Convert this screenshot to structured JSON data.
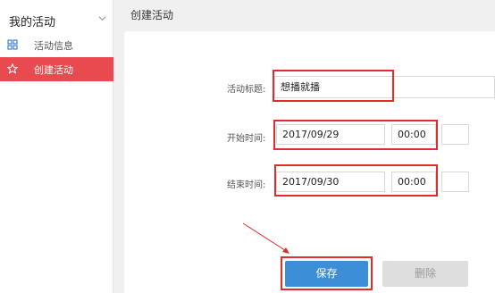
{
  "sidebar": {
    "title": "我的活动",
    "items": [
      {
        "label": "活动信息",
        "icon": "grid-icon"
      },
      {
        "label": "创建活动",
        "icon": "star-icon",
        "active": true
      }
    ]
  },
  "header": {
    "title": "创建活动"
  },
  "form": {
    "title_label": "活动标题:",
    "title_value": "想播就播",
    "start_label": "开始时间:",
    "start_date": "2017/09/29",
    "start_time": "00:00",
    "end_label": "结束时间:",
    "end_date": "2017/09/30",
    "end_time": "00:00"
  },
  "buttons": {
    "save": "保存",
    "delete": "删除"
  },
  "colors": {
    "accent_red": "#e94a4f",
    "primary_blue": "#3c8fd6",
    "annotation_red": "#e32b2b"
  }
}
